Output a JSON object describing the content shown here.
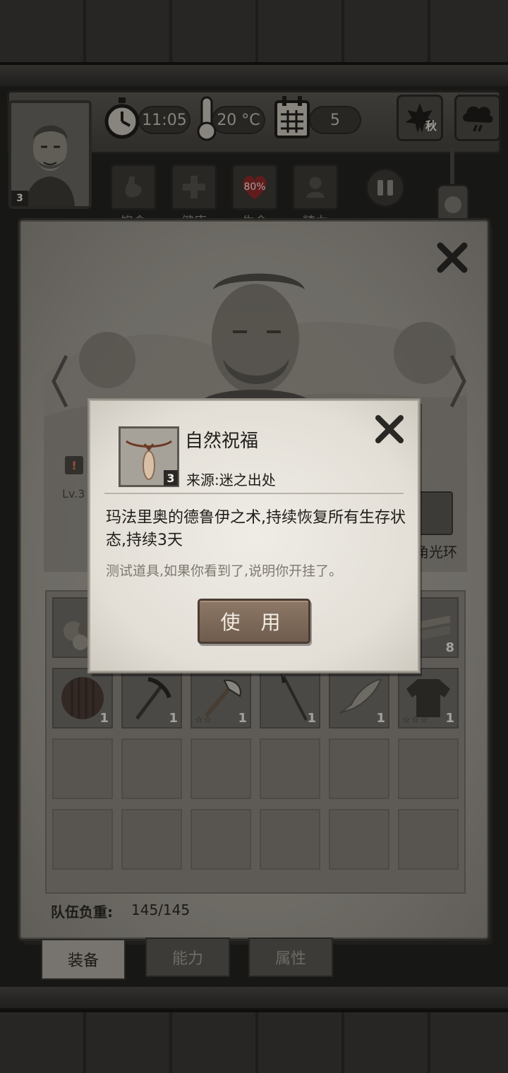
{
  "hud": {
    "time": "11:05",
    "temperature": "20 °C",
    "day": "5",
    "season": "秋",
    "level": "3"
  },
  "stats": [
    {
      "label": "饱食",
      "icon": "stomach-icon"
    },
    {
      "label": "健康",
      "icon": "health-cross-icon"
    },
    {
      "label": "生命",
      "icon": "heart-icon",
      "value": "80%"
    },
    {
      "label": "精力",
      "icon": "person-icon"
    }
  ],
  "sheet": {
    "level_label": "Lv.3",
    "warning": "!",
    "aura_label": "角光环"
  },
  "inventory": {
    "row1": [
      {
        "icon": "food-pile-icon",
        "count": ""
      },
      {
        "icon": "wood-planks-icon",
        "count": "8"
      }
    ],
    "row2": [
      {
        "icon": "wooden-shield-icon",
        "count": "1",
        "stars": ""
      },
      {
        "icon": "pickaxe-icon",
        "count": "1",
        "stars": ""
      },
      {
        "icon": "axe-icon",
        "count": "1",
        "stars": "☆☆"
      },
      {
        "icon": "spear-icon",
        "count": "1",
        "stars": ""
      },
      {
        "icon": "stone-knife-icon",
        "count": "1",
        "stars": ""
      },
      {
        "icon": "jacket-icon",
        "count": "1",
        "stars": "☆☆☆"
      }
    ]
  },
  "team_weight": {
    "label": "队伍负重:",
    "value": "145/145"
  },
  "tabs": [
    {
      "label": "装备",
      "active": true
    },
    {
      "label": "能力",
      "active": false
    },
    {
      "label": "属性",
      "active": false
    }
  ],
  "item_popup": {
    "name": "自然祝福",
    "count": "3",
    "source": "来源:迷之出处",
    "description": "玛法里奥的德鲁伊之术,持续恢复所有生存状态,持续3天",
    "note": "测试道具,如果你看到了,说明你开挂了。",
    "use_button": "使 用"
  },
  "colors": {
    "paper": "#e3dfd7",
    "button_wood": "#7d6858",
    "dark_frame": "#2a2825"
  }
}
